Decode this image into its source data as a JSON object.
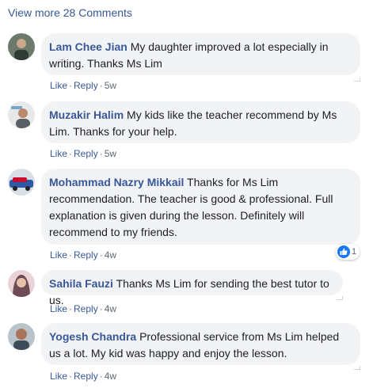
{
  "view_more": "View more 28 Comments",
  "actions": {
    "like": "Like",
    "reply": "Reply",
    "separator": "·"
  },
  "comments": [
    {
      "author": "Lam Chee Jian",
      "text": "My daughter improved a lot especially in writing. Thanks Ms Lim",
      "time": "5w"
    },
    {
      "author": "Muzakir Halim",
      "text": "My kids like the teacher recommend by Ms Lim. Thanks for your help.",
      "time": "5w"
    },
    {
      "author": "Mohammad Nazry Mikkail",
      "text": "Thanks for Ms Lim recommendation. The teacher is good & professional. Full explanation is given during the lesson. Definitely will recommend to my friends.",
      "time": "4w",
      "reaction": {
        "icon": "thumbs-up-icon",
        "count": "1"
      }
    },
    {
      "author": "Sahila Fauzi",
      "text": "Thanks Ms Lim for sending the best tutor to us.",
      "time": "4w"
    },
    {
      "author": "Yogesh Chandra",
      "text": "Professional service from Ms Lim helped us a lot. My kid was happy and enjoy the lesson.",
      "time": "4w"
    }
  ],
  "colors": {
    "link": "#385898",
    "bubble": "#f2f3f5",
    "text": "#1c1e21",
    "meta": "#606770",
    "like_badge": "#1877f2"
  }
}
